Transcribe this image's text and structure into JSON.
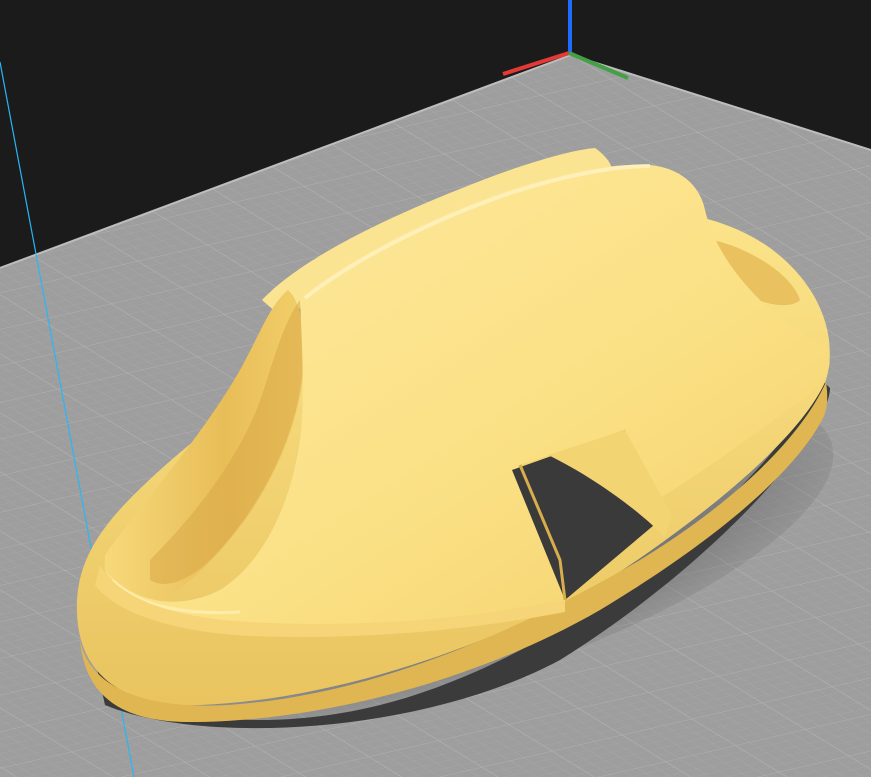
{
  "viewport": {
    "view": "3d-perspective",
    "background_color": "#1b1b1b",
    "build_plate": {
      "color": "#9e9e9e",
      "grid_minor_color": "#aaaaaa",
      "grid_major_color": "#b9b9b9"
    },
    "axis_gizmo": {
      "x_color": "#e53935",
      "y_color": "#43a047",
      "z_color": "#1e6bff"
    },
    "boundary_line_color": "#29b6f6",
    "model": {
      "color": "#fce58a",
      "shade_color": "#e6bb55",
      "shadow_color": "#3a3a3a"
    }
  }
}
